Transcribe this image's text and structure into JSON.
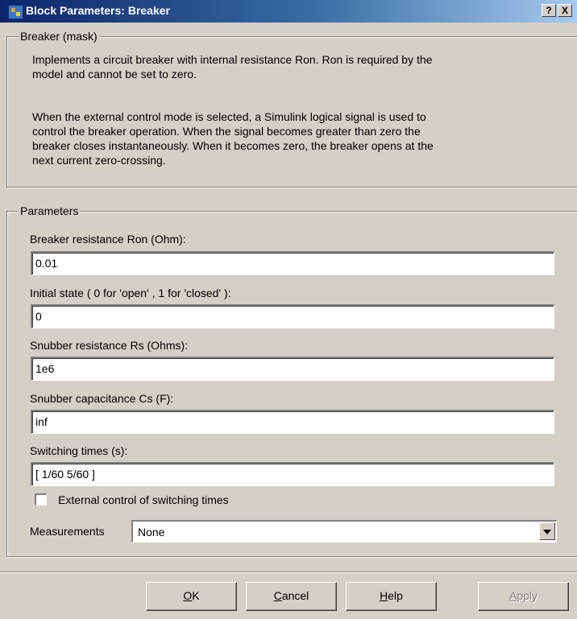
{
  "window": {
    "title": "Block Parameters: Breaker",
    "help_button": "?",
    "close_button": "X"
  },
  "mask_group": {
    "label": "Breaker (mask)",
    "paragraph1_line1": "Implements a circuit breaker with internal resistance Ron. Ron is required by the",
    "paragraph1_line2": "model  and cannot be set to zero.",
    "paragraph2_line1": "When the external control mode is selected, a Simulink  logical signal is used to",
    "paragraph2_line2": "control the breaker operation.  When  the signal becomes greater than zero the",
    "paragraph2_line3": "breaker closes instantaneously.  When it becomes zero, the breaker opens at the",
    "paragraph2_line4": "next current zero-crossing."
  },
  "parameters": {
    "label": "Parameters",
    "fields": [
      {
        "label": "Breaker resistance Ron (Ohm):",
        "value": "0.01"
      },
      {
        "label": "Initial state ( 0 for 'open' , 1 for 'closed' ):",
        "value": "0"
      },
      {
        "label": "Snubber resistance Rs (Ohms):",
        "value": "1e6"
      },
      {
        "label": "Snubber capacitance Cs (F):",
        "value": "inf"
      },
      {
        "label": "Switching times (s):",
        "value": "[ 1/60  5/60 ]"
      }
    ],
    "external_control": {
      "label": "External control of switching times",
      "checked": false
    },
    "measurements": {
      "label": "Measurements",
      "value": "None"
    }
  },
  "buttons": {
    "ok": {
      "mnemonic": "O",
      "rest": "K"
    },
    "cancel": {
      "mnemonic": "C",
      "rest": "ancel"
    },
    "help": {
      "mnemonic": "H",
      "rest": "elp"
    },
    "apply": {
      "mnemonic": "A",
      "rest": "pply"
    }
  }
}
